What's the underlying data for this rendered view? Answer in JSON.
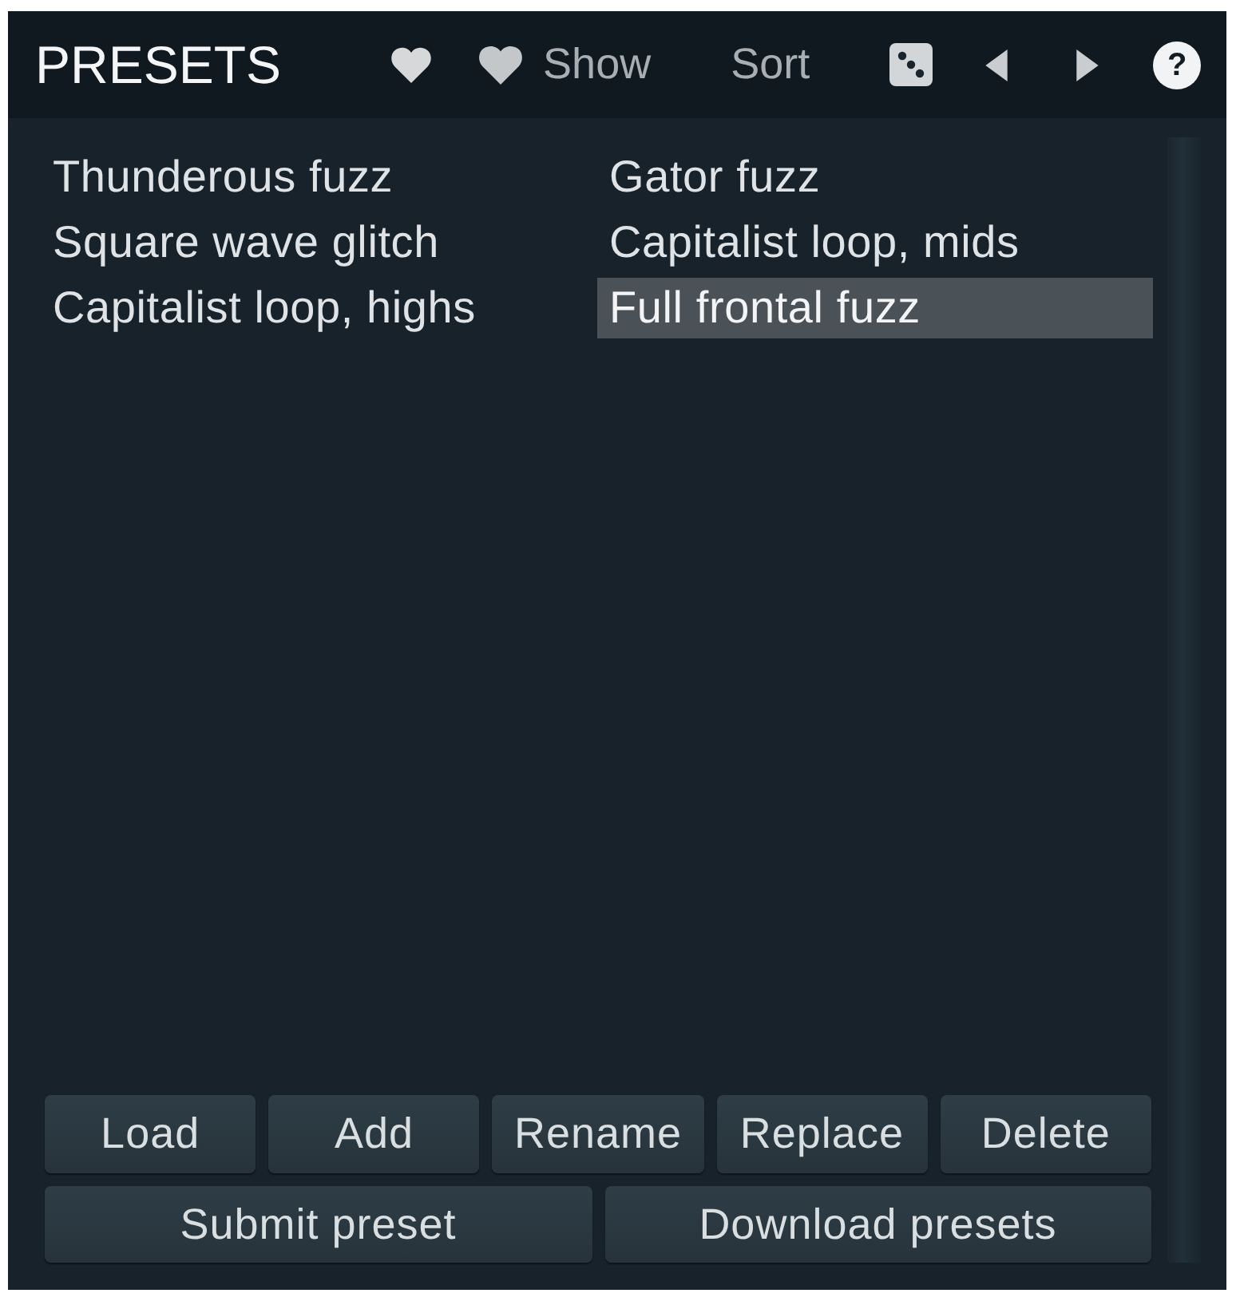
{
  "panel": {
    "title": "PRESETS"
  },
  "toolbar": [
    {
      "kind": "favorite"
    },
    {
      "kind": "show",
      "label": "Show"
    },
    {
      "kind": "sort",
      "label": "Sort"
    },
    {
      "kind": "random"
    },
    {
      "kind": "previous"
    },
    {
      "kind": "next"
    },
    {
      "kind": "help",
      "label": "?"
    }
  ],
  "presets": [
    {
      "name": "Thunderous fuzz",
      "selected": false
    },
    {
      "name": "Gator fuzz",
      "selected": false
    },
    {
      "name": "Square wave glitch",
      "selected": false
    },
    {
      "name": "Capitalist loop, mids",
      "selected": false
    },
    {
      "name": "Capitalist loop, highs",
      "selected": false
    },
    {
      "name": "Full frontal fuzz",
      "selected": true
    }
  ],
  "actions": [
    "Load",
    "Add",
    "Rename",
    "Replace",
    "Delete"
  ],
  "more_actions": [
    "Submit preset",
    "Download presets"
  ]
}
